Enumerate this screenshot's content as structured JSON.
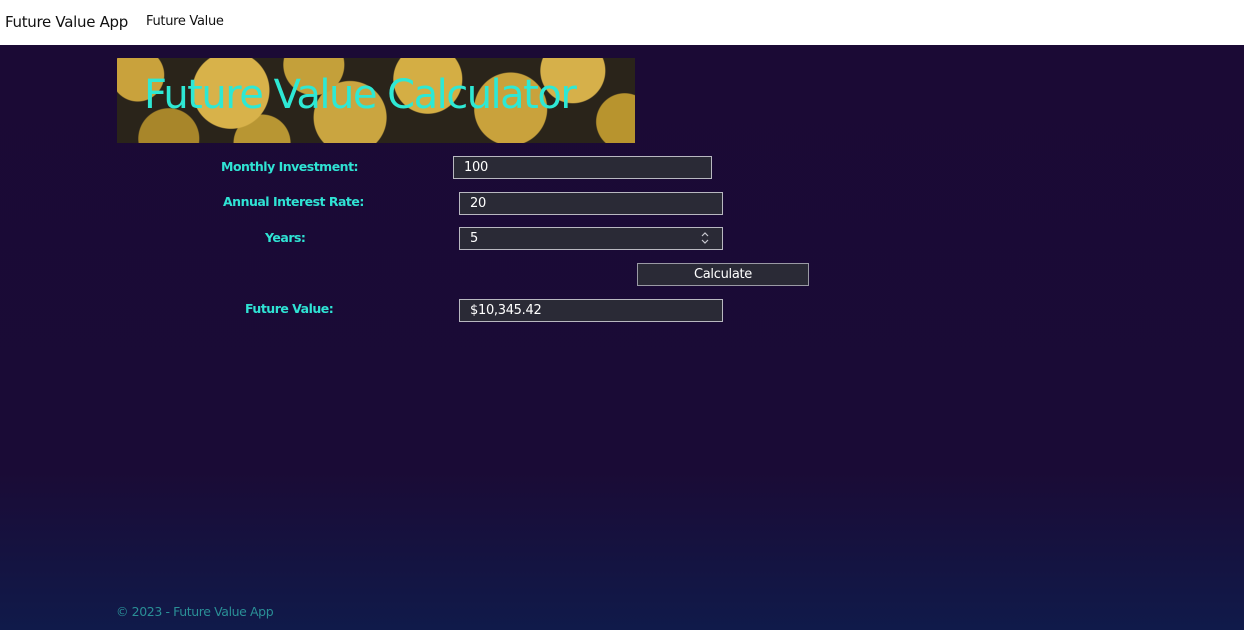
{
  "navbar": {
    "brand": "Future Value App",
    "links": [
      "Future Value"
    ]
  },
  "banner": {
    "title": "Future Value Calculator"
  },
  "form": {
    "monthly_investment": {
      "label": "Monthly Investment:",
      "value": "100"
    },
    "annual_interest_rate": {
      "label": "Annual Interest Rate:",
      "value": "20"
    },
    "years": {
      "label": "Years:",
      "value": "5"
    },
    "calculate_label": "Calculate",
    "future_value": {
      "label": "Future Value:",
      "value": "$10,345.42"
    }
  },
  "footer": {
    "text": "© 2023 - Future Value App"
  },
  "colors": {
    "accent": "#2ee8d4",
    "background": "#1b0a35",
    "input_bg": "#2a2a36"
  }
}
